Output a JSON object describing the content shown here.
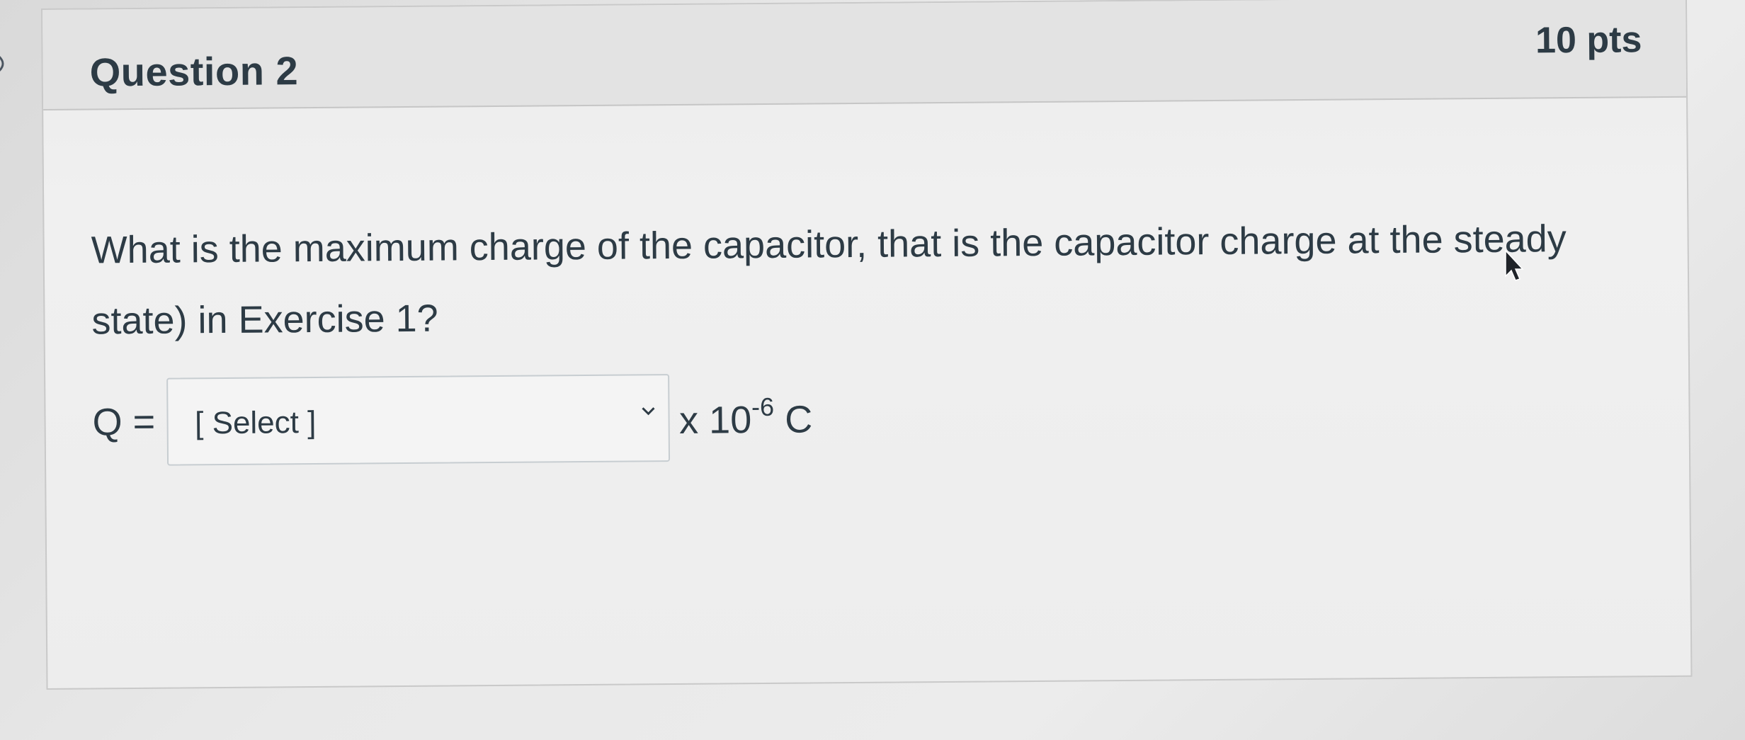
{
  "question": {
    "title": "Question 2",
    "points": "10 pts",
    "text": "What is the maximum charge of the capacitor, that is the capacitor charge at the steady state) in Exercise 1?"
  },
  "answer": {
    "variable": "Q =",
    "select_placeholder": "[ Select ]",
    "unit_prefix": "x 10",
    "unit_exponent": "-6",
    "unit_suffix": " C"
  },
  "icons": {
    "flag": "chevron-right-icon",
    "dropdown": "chevron-down-icon",
    "cursor": "mouse-pointer-icon"
  },
  "colors": {
    "text": "#2d3b45",
    "card_border": "#c9c9c9",
    "select_border": "#c7cdd1"
  }
}
